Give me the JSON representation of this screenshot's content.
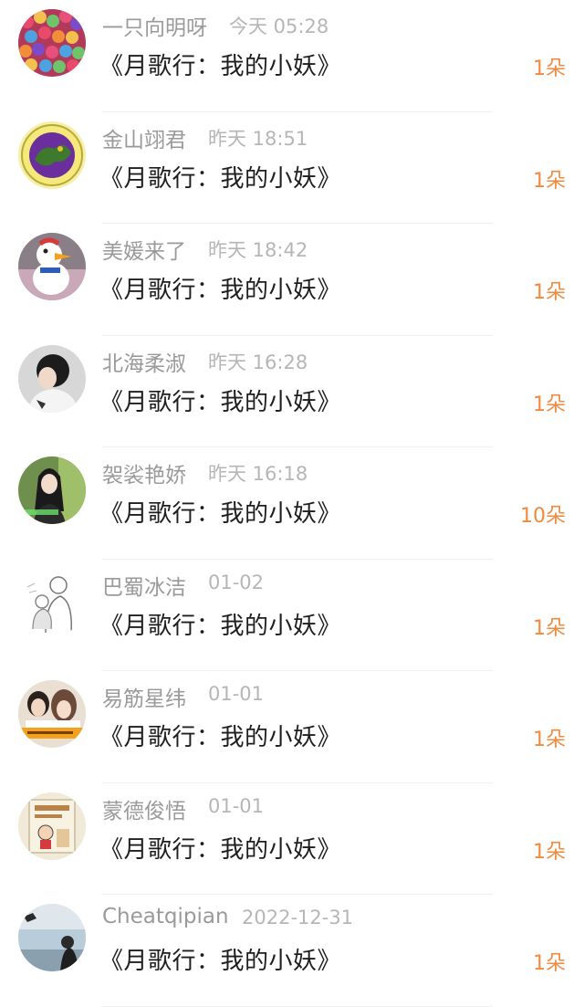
{
  "items": [
    {
      "name": "一只向明呀",
      "time": "今天 05:28",
      "title": "《月歌行：我的小妖》",
      "gift": "1朵",
      "avatar": "colorful-candy-avatar"
    },
    {
      "name": "金山翊君",
      "time": "昨天 18:51",
      "title": "《月歌行：我的小妖》",
      "gift": "1朵",
      "avatar": "purple-dragon-emblem-avatar"
    },
    {
      "name": "美媛来了",
      "time": "昨天 18:42",
      "title": "《月歌行：我的小妖》",
      "gift": "1朵",
      "avatar": "duck-toy-avatar"
    },
    {
      "name": "北海柔淑",
      "time": "昨天 16:28",
      "title": "《月歌行：我的小妖》",
      "gift": "1朵",
      "avatar": "girl-covering-face-avatar"
    },
    {
      "name": "袈裟艳娇",
      "time": "昨天 16:18",
      "title": "《月歌行：我的小妖》",
      "gift": "10朵",
      "avatar": "woman-portrait-avatar"
    },
    {
      "name": "巴蜀冰洁",
      "time": "01-02",
      "title": "《月歌行：我的小妖》",
      "gift": "1朵",
      "avatar": "sketch-mother-child-avatar"
    },
    {
      "name": "易筋星纬",
      "time": "01-01",
      "title": "《月歌行：我的小妖》",
      "gift": "1朵",
      "avatar": "couple-photo-avatar"
    },
    {
      "name": "蒙德俊悟",
      "time": "01-01",
      "title": "《月歌行：我的小妖》",
      "gift": "1朵",
      "avatar": "cartoon-poster-avatar"
    },
    {
      "name": "Cheatqipian",
      "time": "2022-12-31",
      "title": "《月歌行：我的小妖》",
      "gift": "1朵",
      "avatar": "seaside-person-avatar"
    }
  ],
  "colors": {
    "gift": "#f08a3e",
    "name": "#9a9a9a",
    "time": "#b6b6b6",
    "title": "#1e1e1e"
  }
}
